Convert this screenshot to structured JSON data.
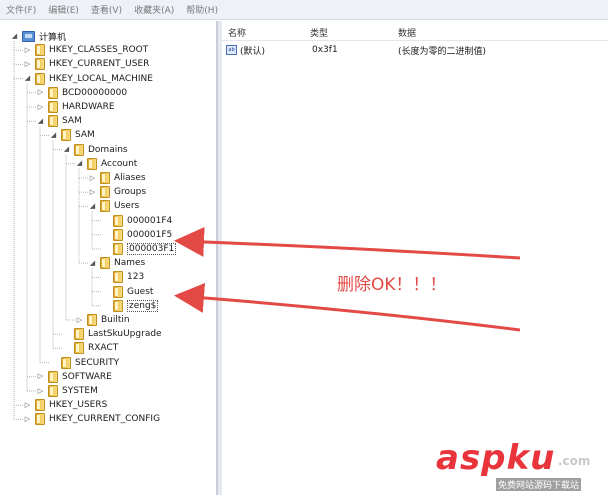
{
  "menubar": {
    "items": [
      "文件(F)",
      "编辑(E)",
      "查看(V)",
      "收藏夹(A)",
      "帮助(H)"
    ]
  },
  "tree": {
    "nodes": [
      {
        "label": "计算机",
        "expander": "◢",
        "icon": "computer-icon"
      },
      {
        "label": "HKEY_CLASSES_ROOT",
        "expander": "▷",
        "icon": "folder-icon"
      },
      {
        "label": "HKEY_CURRENT_USER",
        "expander": "▷",
        "icon": "folder-icon"
      },
      {
        "label": "HKEY_LOCAL_MACHINE",
        "expander": "◢",
        "icon": "folder-icon"
      },
      {
        "label": "BCD00000000",
        "expander": "▷",
        "icon": "folder-icon"
      },
      {
        "label": "HARDWARE",
        "expander": "▷",
        "icon": "folder-icon"
      },
      {
        "label": "SAM",
        "expander": "◢",
        "icon": "folder-icon"
      },
      {
        "label": "SAM",
        "expander": "◢",
        "icon": "folder-icon"
      },
      {
        "label": "Domains",
        "expander": "◢",
        "icon": "folder-icon"
      },
      {
        "label": "Account",
        "expander": "◢",
        "icon": "folder-icon"
      },
      {
        "label": "Aliases",
        "expander": "▷",
        "icon": "folder-icon"
      },
      {
        "label": "Groups",
        "expander": "▷",
        "icon": "folder-icon"
      },
      {
        "label": "Users",
        "expander": "◢",
        "icon": "folder-icon"
      },
      {
        "label": "000001F4",
        "expander": "",
        "icon": "folder-icon"
      },
      {
        "label": "000001F5",
        "expander": "",
        "icon": "folder-icon"
      },
      {
        "label": "000003F1",
        "expander": "",
        "icon": "folder-icon",
        "selected": true
      },
      {
        "label": "Names",
        "expander": "◢",
        "icon": "folder-icon"
      },
      {
        "label": "123",
        "expander": "",
        "icon": "folder-icon"
      },
      {
        "label": "Guest",
        "expander": "",
        "icon": "folder-icon"
      },
      {
        "label": "zeng$",
        "expander": "",
        "icon": "folder-icon",
        "selected": true
      },
      {
        "label": "Builtin",
        "expander": "▷",
        "icon": "folder-icon"
      },
      {
        "label": "LastSkuUpgrade",
        "expander": "",
        "icon": "folder-icon"
      },
      {
        "label": "RXACT",
        "expander": "",
        "icon": "folder-icon"
      },
      {
        "label": "SECURITY",
        "expander": "",
        "icon": "folder-icon"
      },
      {
        "label": "SOFTWARE",
        "expander": "▷",
        "icon": "folder-icon"
      },
      {
        "label": "SYSTEM",
        "expander": "▷",
        "icon": "folder-icon"
      },
      {
        "label": "HKEY_USERS",
        "expander": "▷",
        "icon": "folder-icon"
      },
      {
        "label": "HKEY_CURRENT_CONFIG",
        "expander": "▷",
        "icon": "folder-icon"
      }
    ]
  },
  "list": {
    "columns": {
      "name": "名称",
      "type": "类型",
      "data": "数据"
    },
    "rows": [
      {
        "icon": "ab",
        "name": "(默认)",
        "type": "0x3f1",
        "data": "(长度为零的二进制值)"
      }
    ]
  },
  "annotation": {
    "text": "删除OK！！！",
    "color": "#e34a45"
  },
  "watermark": {
    "logo": "aspku",
    "tld": ".com",
    "slogan": "免费网站源码下载站"
  }
}
